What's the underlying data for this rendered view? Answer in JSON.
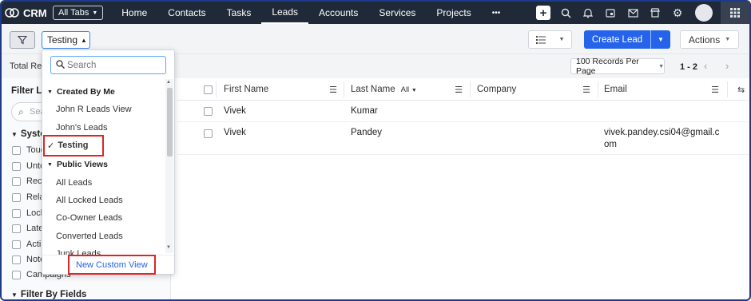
{
  "topnav": {
    "brand": "CRM",
    "all_tabs": "All Tabs",
    "tabs": [
      {
        "label": "Home",
        "active": false
      },
      {
        "label": "Contacts",
        "active": false
      },
      {
        "label": "Tasks",
        "active": false
      },
      {
        "label": "Leads",
        "active": true
      },
      {
        "label": "Accounts",
        "active": false
      },
      {
        "label": "Services",
        "active": false
      },
      {
        "label": "Projects",
        "active": false
      }
    ],
    "more": "•••",
    "icons": [
      "plus-icon",
      "search-icon",
      "bell-icon",
      "calendar-icon",
      "mail-icon",
      "store-icon",
      "gear-icon",
      "avatar",
      "apps-grid-icon"
    ]
  },
  "toolbar": {
    "view_selected": "Testing",
    "create_label": "Create Lead",
    "actions_label": "Actions"
  },
  "records": {
    "total_label": "Total Reco",
    "per_page": "100 Records Per Page",
    "page_range": "1 - 2"
  },
  "filters": {
    "heading": "Filter Le",
    "search_placeholder": "Sea",
    "system_heading": "Syste",
    "items": [
      "Touc",
      "Unto",
      "Reco",
      "Rela",
      "Lock",
      "Late",
      "Acti",
      "Note",
      "Campaigns"
    ],
    "by_fields": "Filter By Fields"
  },
  "table": {
    "columns": [
      {
        "label": "First Name",
        "tag": ""
      },
      {
        "label": "Last Name",
        "tag": "All"
      },
      {
        "label": "Company",
        "tag": ""
      },
      {
        "label": "Email",
        "tag": ""
      }
    ],
    "rows": [
      {
        "first": "Vivek",
        "last": "Kumar",
        "company": "",
        "email_1": "",
        "email_2": ""
      },
      {
        "first": "Vivek",
        "last": "Pandey",
        "company": "",
        "email_1": "vivek.pandey.csi04@gmail.c",
        "email_2": "om"
      }
    ]
  },
  "dropdown": {
    "search_placeholder": "Search",
    "created_by_me": "Created By Me",
    "my_views": [
      "John R Leads View",
      "John's Leads"
    ],
    "selected_view": "Testing",
    "public_views": "Public Views",
    "public_list": [
      "All Leads",
      "All Locked Leads",
      "Co-Owner Leads",
      "Converted Leads",
      "Junk Leads"
    ],
    "new_custom_view": "New Custom View"
  },
  "colors": {
    "nav_bg": "#1f2937",
    "accent": "#2563eb",
    "highlight_box": "#dc2626",
    "frame": "#1e3a8a"
  }
}
